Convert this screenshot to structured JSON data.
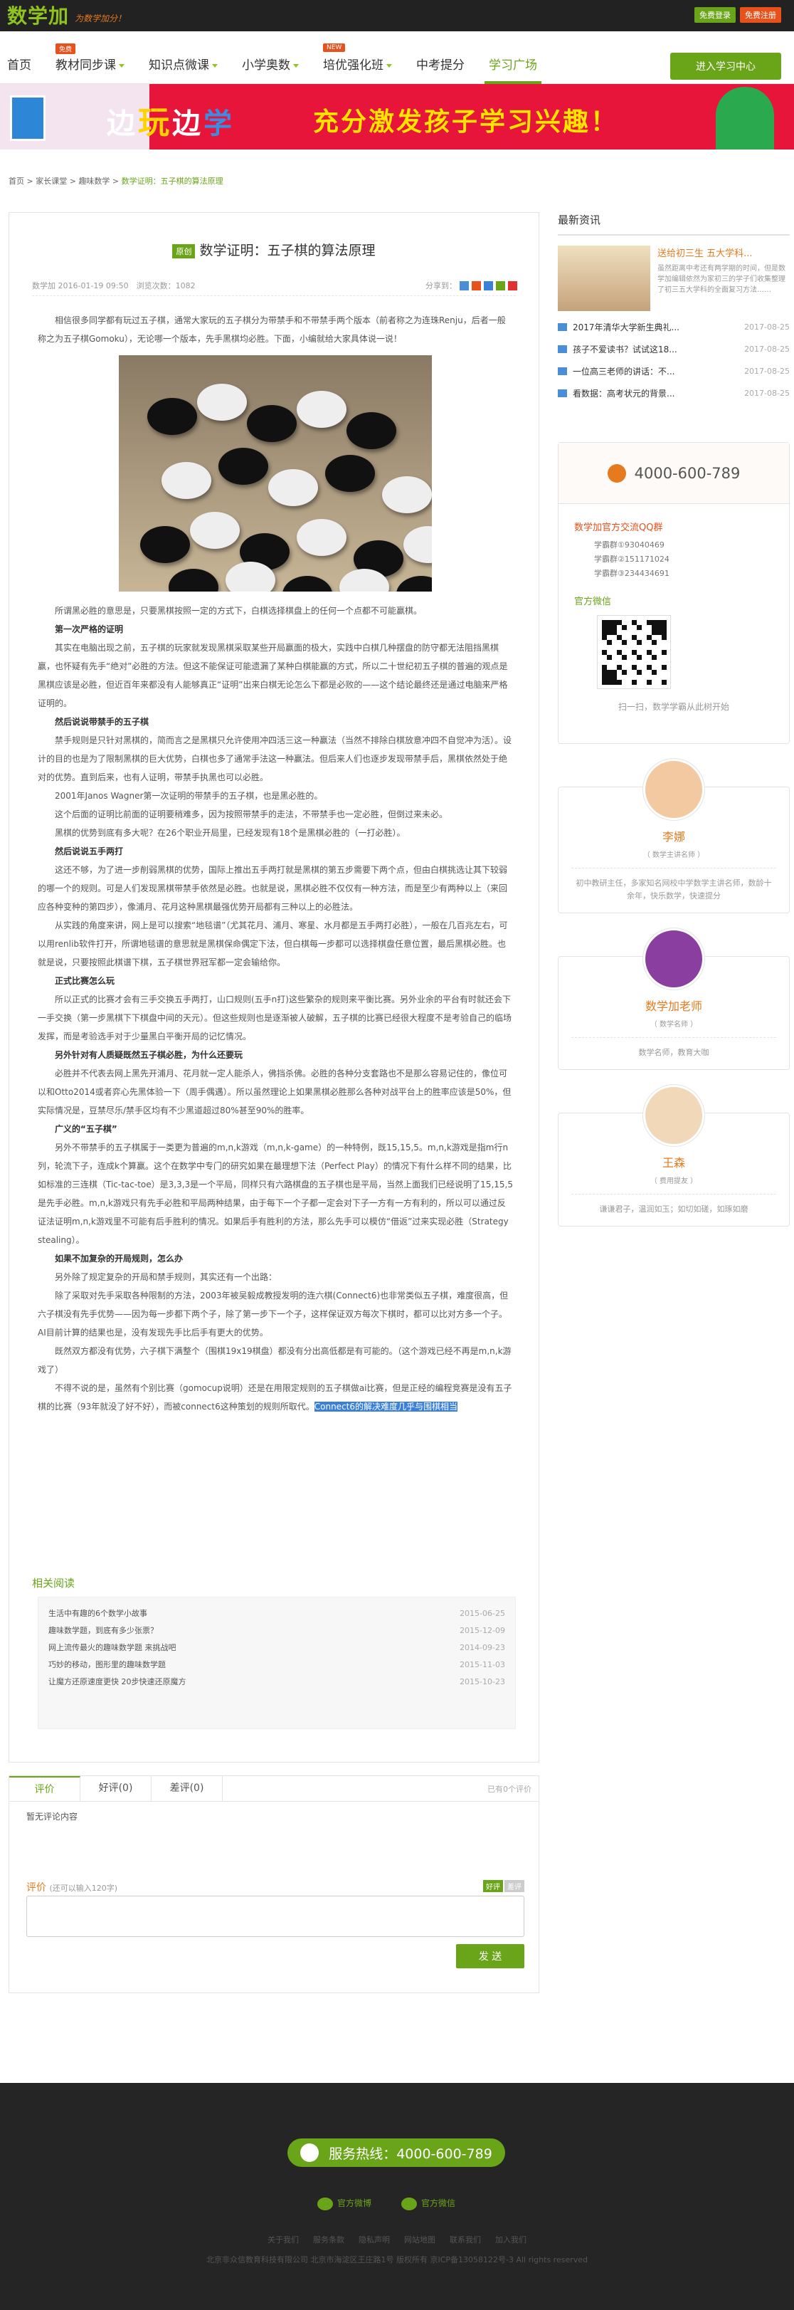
{
  "header": {
    "logo": "数学加",
    "slogan": "为数学加分！",
    "free_btn": "免费登录",
    "reg_btn": "免费注册"
  },
  "nav": {
    "items": [
      {
        "label": "首页",
        "badge": "",
        "caret": false,
        "active": false
      },
      {
        "label": "教材同步课",
        "badge": "免费",
        "caret": true,
        "active": false
      },
      {
        "label": "知识点微课",
        "badge": "",
        "caret": true,
        "active": false
      },
      {
        "label": "小学奥数",
        "badge": "",
        "caret": true,
        "active": false
      },
      {
        "label": "培优强化班",
        "badge": "NEW",
        "caret": true,
        "active": false
      },
      {
        "label": "中考提分",
        "badge": "",
        "caret": false,
        "active": false
      },
      {
        "label": "学习广场",
        "badge": "",
        "caret": false,
        "active": true
      }
    ],
    "study_btn": "进入学习中心"
  },
  "banner": {
    "w1": "边",
    "w2": "玩",
    "w3": "边",
    "w4": "学",
    "slogan": "充分激发孩子学习兴趣！"
  },
  "breadcrumb": {
    "home": "首页",
    "s1": "家长课堂",
    "s2": "趣味数学",
    "s3": "数学证明：五子棋的算法原理"
  },
  "article": {
    "tag": "原创",
    "title": "数学证明：五子棋的算法原理",
    "meta": "数学加 2016-01-19 09:50　浏览次数：1082",
    "share_label": "分享到：",
    "intro": "相信很多同学都有玩过五子棋，通常大家玩的五子棋分为带禁手和不带禁手两个版本（前者称之为连珠Renju，后者一般称之为五子棋Gomoku），无论哪一个版本，先手黑棋均必胜。下面，小编就给大家具体说一说！",
    "paragraphs": [
      {
        "h": false,
        "t": "所谓黑必胜的意思是，只要黑棋按照一定的方式下，白棋选择棋盘上的任何一个点都不可能赢棋。"
      },
      {
        "h": true,
        "t": "第一次严格的证明"
      },
      {
        "h": false,
        "t": "其实在电脑出现之前，五子棋的玩家就发现黑棋采取某些开局赢面的极大，实践中白棋几种摆盘的防守都无法阻挡黑棋赢，也怀疑有先手“绝对”必胜的方法。但这不能保证可能遗漏了某种白棋能赢的方式，所以二十世纪初五子棋的普遍的观点是黑棋应该是必胜，但近百年来都没有人能够真正“证明”出来白棋无论怎么下都是必败的——这个结论最终还是通过电脑来严格证明的。"
      },
      {
        "h": true,
        "t": "然后说说带禁手的五子棋"
      },
      {
        "h": false,
        "t": "禁手规则是只针对黑棋的，简而言之是黑棋只允许使用冲四活三这一种赢法（当然不排除白棋放意冲四不自觉冲为活）。设计的目的也是为了限制黑棋的巨大优势，白棋也多了通常手法这一种赢法。但后来人们也逐步发现带禁手后，黑棋依然处于绝对的优势。直到后来，也有人证明，带禁手执黑也可以必胜。"
      },
      {
        "h": false,
        "t": "2001年Janos Wagner第一次证明的带禁手的五子棋，也是黑必胜的。"
      },
      {
        "h": false,
        "t": "这个后面的证明比前面的证明要稍难多，因为按照带禁手的走法，不带禁手也一定必胜，但倒过来未必。"
      },
      {
        "h": false,
        "t": "黑棋的优势到底有多大呢？在26个职业开局里，已经发现有18个是黑棋必胜的（一打必胜）。"
      },
      {
        "h": true,
        "t": "然后说说五手两打"
      },
      {
        "h": false,
        "t": "这还不够，为了进一步削弱黑棋的优势，国际上推出五手两打就是黑棋的第五步需要下两个点，但由白棋挑选让其下较弱的哪一个的规则。可是人们发现黑棋带禁手依然是必胜。也就是说，黑棋必胜不仅仅有一种方法，而是至少有两种以上（来回应各种变种的第四步），像浦月、花月这种黑棋最强优势开局都有三种以上的必胜法。"
      },
      {
        "h": false,
        "t": "从实践的角度来讲，网上是可以搜索“地毯谱”（尤其花月、浦月、寒星、水月都是五手两打必胜），一般在几百兆左右，可以用renlib软件打开，所谓地毯谱的意思就是黑棋保命偶定下法，但白棋每一步都可以选择棋盘任意位置，最后黑棋必胜。也就是说，只要按照此棋谱下棋，五子棋世界冠军都一定会输给你。"
      },
      {
        "h": true,
        "t": "正式比赛怎么玩"
      },
      {
        "h": false,
        "t": "所以正式的比赛才会有三手交换五手两打，山口规则(五手n打)这些繁杂的规则来平衡比赛。另外业余的平台有时就还会下一手交换（第一步黑棋下下棋盘中间的天元）。但这些规则也是逐渐被人破解，五子棋的比赛已经很大程度不是考验自己的临场发挥，而是考验选手对于少量黑白平衡开局的记忆情况。"
      },
      {
        "h": true,
        "t": "另外针对有人质疑既然五子棋必胜，为什么还要玩"
      },
      {
        "h": false,
        "t": "必胜并不代表去网上黑先开浦月、花月就一定人能杀人，佛挡杀佛。必胜的各种分支套路也不是那么容易记住的，像位可以和Otto2014或者弈心先黑体验一下（周手偶遇）。所以虽然理论上如果黑棋必胜那么各种对战平台上的胜率应该是50%，但实际情况是，豆禁尽乐/禁手区均有不少黑道超过80%甚至90%的胜率。"
      },
      {
        "h": true,
        "t": "广义的“五子棋”"
      },
      {
        "h": false,
        "t": "另外不带禁手的五子棋属于一类更为普遍的m,n,k游戏（m,n,k-game）的一种特例，既15,15,5。m,n,k游戏是指m行n列，轮流下子，连成k个算赢。这个在数学中专门的研究如果在最理想下法（Perfect Play）的情况下有什么样不同的结果，比如标准的三连棋（Tic-tac-toe）是3,3,3是一个平局，同样只有六路棋盘的五子棋也是平局，当然上面我们已经说明了15,15,5是先手必胜。m,n,k游戏只有先手必胜和平局两种结果，由于每下一个子都一定会对下子一方有一方有利的，所以可以通过反证法证明m,n,k游戏里不可能有后手胜利的情况。如果后手有胜利的方法，那么先手可以模仿“借返”过来实现必胜（Strategy stealing）。"
      },
      {
        "h": true,
        "t": "如果不加复杂的开局规则，怎么办"
      },
      {
        "h": false,
        "t": "另外除了规定复杂的开局和禁手规则，其实还有一个出路："
      },
      {
        "h": false,
        "t": "除了采取对先手采取各种限制的方法，2003年被吴毅成教授发明的连六棋(Connect6)也非常类似五子棋，难度很高，但六子棋没有先手优势——因为每一步都下两个子，除了第一步下一个子，这样保证双方每次下棋时，都可以比对方多一个子。AI目前计算的结果也是，没有发现先手比后手有更大的优势。"
      },
      {
        "h": false,
        "t": "既然双方都没有优势，六子棋下满整个（围棋19x19棋盘）都没有分出高低都是有可能的。（这个游戏已经不再是m,n,k游戏了）"
      },
      {
        "h": false,
        "t": "不得不说的是，虽然有个别比赛（gomocup说明）还是在用限定规则的五子棋做ai比赛，但是正经的编程竞赛是没有五子棋的比赛（93年就没了好不好），而被connect6这种策划的规则所取代。",
        "sel": "Connect6的解决难度几乎与围棋相当"
      }
    ]
  },
  "related": {
    "title": "相关阅读",
    "items": [
      {
        "t": "生活中有趣的6个数学小故事",
        "d": "2015-06-25"
      },
      {
        "t": "趣味数学题，到底有多少张票？",
        "d": "2015-12-09"
      },
      {
        "t": "网上流传最火的趣味数学题 来挑战吧",
        "d": "2014-09-23"
      },
      {
        "t": "巧妙的移动，图形里的趣味数学题",
        "d": "2015-11-03"
      },
      {
        "t": "让魔方还原速度更快 20步快速还原魔方",
        "d": "2015-10-23"
      }
    ]
  },
  "comments": {
    "tabs": [
      "评价",
      "好评(0)",
      "差评(0)"
    ],
    "count": "已有0个评价",
    "none": "暂无评论内容",
    "label": "评价",
    "hint": "(还可以输入120字)",
    "good": "好评",
    "bad": "差评",
    "send": "发 送"
  },
  "sidebar": {
    "news_title": "最新资讯",
    "top_title": "送给初三生 五大学科...",
    "top_desc": "虽然距离中考还有两学期的时间，但是数学加编辑依然为家初三的学子们收集整理了初三五大学科的全面复习方法……",
    "news": [
      {
        "t": "2017年清华大学新生典礼...",
        "d": "2017-08-25"
      },
      {
        "t": "孩子不爱读书？试试这18...",
        "d": "2017-08-25"
      },
      {
        "t": "一位高三老师的讲话：不...",
        "d": "2017-08-25"
      },
      {
        "t": "看数据：高考状元的背景...",
        "d": "2017-08-25"
      }
    ],
    "phone": "4000-600-789",
    "qq_title": "数学加官方交流QQ群",
    "qq": [
      "学霸群①93040469",
      "学霸群②151171024",
      "学霸群③234434691"
    ],
    "wx_title": "官方微信",
    "qr_text": "扫一扫，数学学霸从此树开始",
    "teachers": [
      {
        "name": "李娜",
        "role": "（ 数学主讲名师 ）",
        "desc": "初中教研主任，多家知名网校中学数学主讲名师，数龄十余年，快乐数学，快速提分"
      },
      {
        "name": "数学加老师",
        "role": "（ 数学名师 ）",
        "desc": "数学名师，教育大咖"
      },
      {
        "name": "王森",
        "role": "（ 费用提友 ）",
        "desc": "谦谦君子，温润如玉；如切如磋，如琢如磨"
      }
    ]
  },
  "footer": {
    "hotline": "服务热线：4000-600-789",
    "weibo": "官方微博",
    "weixin": "官方微信",
    "links": [
      "关于我们",
      "服务条款",
      "隐私声明",
      "网站地图",
      "联系我们",
      "加入我们"
    ],
    "copyright": "北京非众信教育科技有限公司 北京市海淀区王庄路1号 版权所有 京ICP备13058122号-3 All rights reserved"
  },
  "colors": {
    "brand": "#6aa519",
    "accent": "#e67a1e",
    "banner": "#e7153a"
  }
}
